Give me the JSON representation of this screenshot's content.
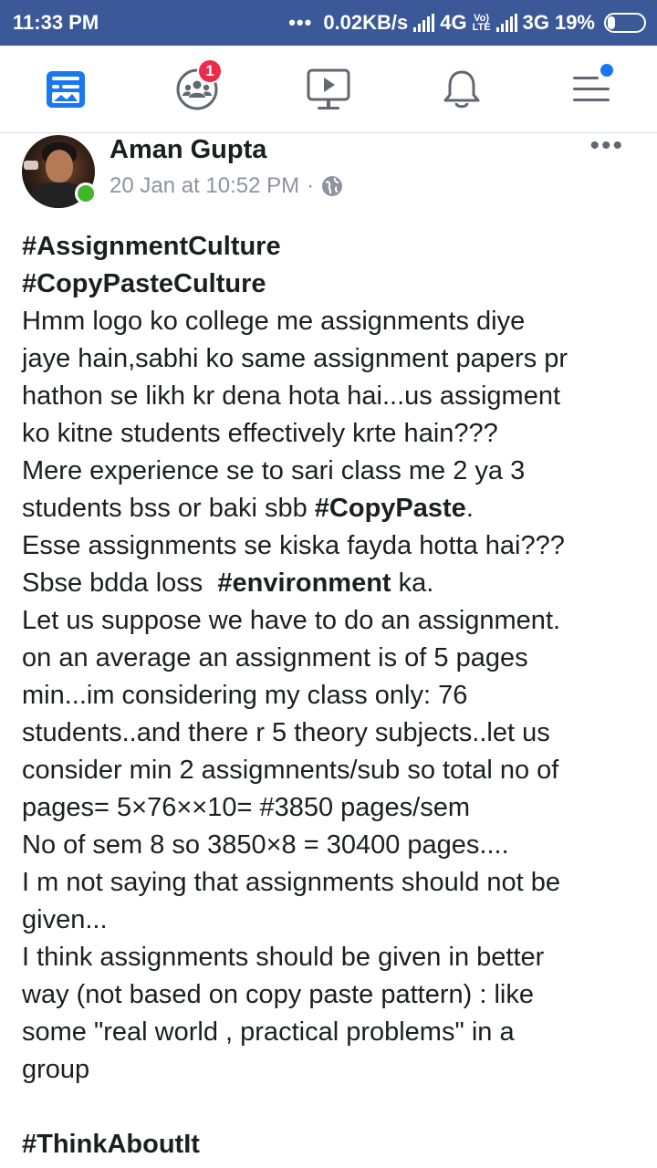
{
  "status_bar": {
    "time": "11:33 PM",
    "speed": "0.02KB/s",
    "net1": "4G",
    "lte_top": "Vo)",
    "lte_bottom": "LTE",
    "net2": "3G",
    "battery": "19%"
  },
  "nav": {
    "items": [
      {
        "icon": "news-feed-icon"
      },
      {
        "icon": "groups-icon",
        "badge": "1"
      },
      {
        "icon": "watch-video-icon"
      },
      {
        "icon": "notifications-bell-icon"
      },
      {
        "icon": "menu-icon"
      }
    ]
  },
  "post": {
    "author": "Aman Gupta",
    "timestamp": "20 Jan at 10:52 PM",
    "separator": "·",
    "privacy_icon": "globe-icon",
    "more_label": "•••",
    "lines": [
      {
        "bold": "#AssignmentCulture"
      },
      {
        "bold": "#CopyPasteCulture"
      },
      {
        "text": "Hmm logo ko college me assignments diye"
      },
      {
        "text": "jaye hain,sabhi ko same assignment papers pr"
      },
      {
        "text": "hathon se likh kr dena hota hai...us assigment"
      },
      {
        "text": "ko kitne students effectively krte hain???"
      },
      {
        "text": "Mere experience se to sari class me 2 ya 3"
      },
      {
        "pre": "students bss or baki sbb ",
        "bold": "#CopyPaste",
        "post": "."
      },
      {
        "text": "Esse assignments se kiska fayda hotta hai???"
      },
      {
        "pre": "Sbse bdda loss  ",
        "bold": "#environment",
        "post": " ka."
      },
      {
        "text": "Let us suppose we have to do an assignment."
      },
      {
        "text": "on an average an assignment is of 5 pages"
      },
      {
        "text": "min...im considering my class only: 76"
      },
      {
        "text": "students..and there r 5 theory subjects..let us"
      },
      {
        "text": "consider min 2 assigmnents/sub so total no of"
      },
      {
        "text": "pages= 5×76××10= #3850 pages/sem"
      },
      {
        "text": "No of sem 8 so 3850×8 = 30400 pages...."
      },
      {
        "text": "I m not saying that assignments should not be"
      },
      {
        "text": "given..."
      },
      {
        "text": "I think assignments should be given in better"
      },
      {
        "text": "way (not based on copy paste pattern) : like"
      },
      {
        "text": "some \"real world , practical problems\" in a"
      },
      {
        "text": "group"
      },
      {
        "text": ""
      },
      {
        "bold": "#ThinkAboutIt"
      }
    ]
  }
}
